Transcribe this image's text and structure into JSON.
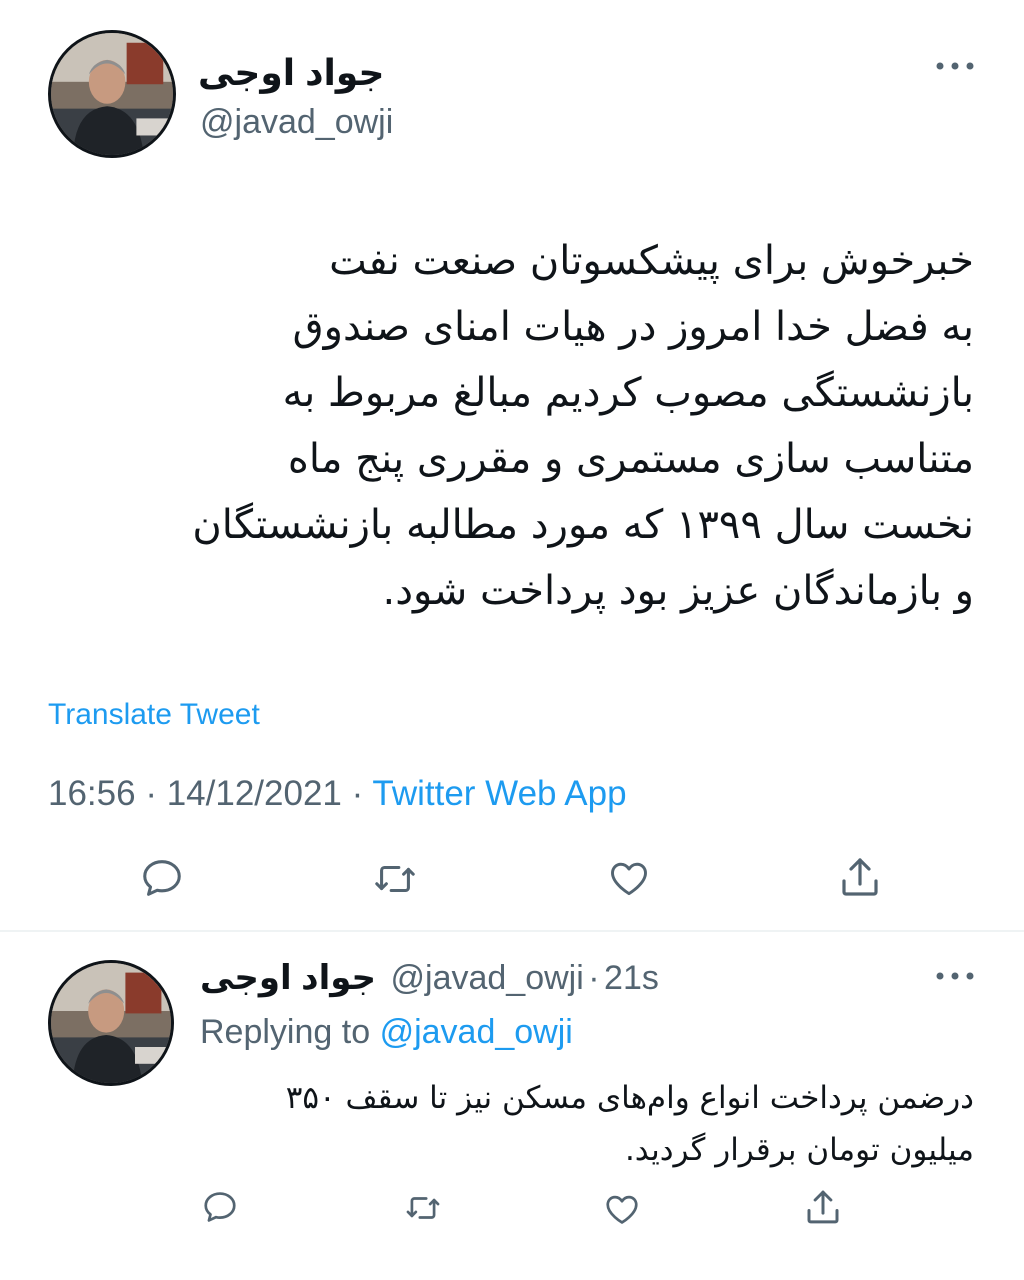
{
  "main_tweet": {
    "author_name": "جواد اوجی",
    "author_handle": "@javad_owji",
    "more_icon": "more-dots-icon",
    "text_lines": [
      "خبرخوش برای پیشکسوتان صنعت نفت",
      "به فضل خدا امروز در هیات امنای صندوق",
      "بازنشستگی مصوب کردیم مبالغ مربوط به",
      "متناسب سازی مستمری و مقرری پنج ماه",
      "نخست سال ۱۳۹۹ که مورد مطالبه بازنشستگان",
      "و بازماندگان عزیز بود پرداخت شود."
    ],
    "translate_label": "Translate Tweet",
    "time": "16:56",
    "separator": "·",
    "date": "14/12/2021",
    "source": "Twitter Web App",
    "actions": [
      "reply-icon",
      "retweet-icon",
      "like-icon",
      "share-icon"
    ]
  },
  "reply_tweet": {
    "author_name": "جواد اوجی",
    "author_handle": "@javad_owji",
    "separator": "·",
    "age": "21s",
    "replying_prefix": "Replying to",
    "replying_handle": "@javad_owji",
    "text_lines": [
      "درضمن پرداخت انواع وام‌های مسکن نیز تا سقف ۳۵۰",
      "میلیون تومان برقرار گردید."
    ],
    "actions": [
      "reply-icon",
      "retweet-icon",
      "like-icon",
      "share-icon"
    ]
  },
  "colors": {
    "accent": "#1d9bf0",
    "text": "#0f1419",
    "secondary": "#536471",
    "divider": "#eff3f4"
  }
}
